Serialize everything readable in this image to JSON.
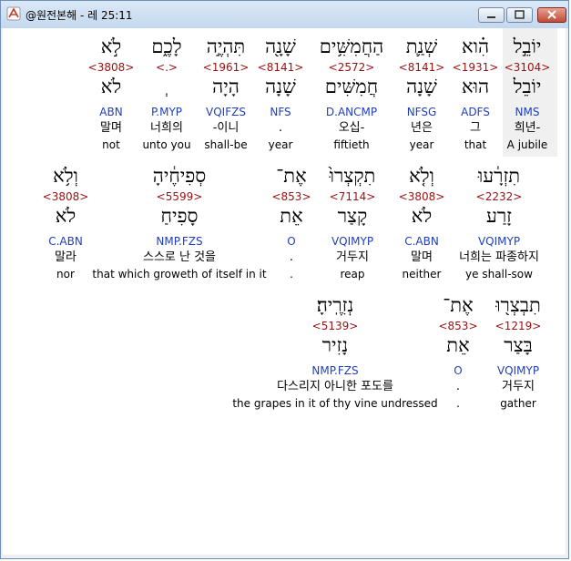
{
  "window": {
    "title": "@원전본해 - 레 25:11",
    "colors": {
      "strong": "#9a1010",
      "parse": "#1f3fbf",
      "highlight": "#f0f0f0"
    }
  },
  "rows": [
    {
      "words": [
        {
          "heb": "יוֹבֵ֣ל",
          "strong": "<3104>",
          "lemma": "יוֹבֵל",
          "parse": "NMS",
          "kor": "희년-",
          "eng": "A jubile"
        },
        {
          "heb": "הִ֗וא",
          "strong": "<1931>",
          "lemma": "הוּא",
          "parse": "ADFS",
          "kor": "그",
          "eng": "that"
        },
        {
          "heb": "שְׁנַ֛ת",
          "strong": "<8141>",
          "lemma": "שָׁנָה",
          "parse": "NFSG",
          "kor": "년은",
          "eng": "year"
        },
        {
          "heb": "הַחֲמִשִּׁ֥ים",
          "strong": "<2572>",
          "lemma": "חֲמִשִּׁים",
          "parse": "D.ANCMP",
          "kor": "오십-",
          "eng": "fiftieth"
        },
        {
          "heb": "שָׁנָ֖ה",
          "strong": "<8141>",
          "lemma": "שָׁנָה",
          "parse": "NFS",
          "kor": ".",
          "eng": "year"
        },
        {
          "heb": "תִּהְיֶ֣ה",
          "strong": "<1961>",
          "lemma": "הָיָה",
          "parse": "VQIFZS",
          "kor": "-이니",
          "eng": "shall-be"
        },
        {
          "heb": "לָכֶ֑ם",
          "strong": "<.>",
          "lemma": "ְ",
          "parse": "P.MYP",
          "kor": "너희의",
          "eng": "unto you"
        },
        {
          "heb": "לֹ֣א",
          "strong": "<3808>",
          "lemma": "לֹא",
          "parse": "ABN",
          "kor": "말며",
          "eng": "not"
        }
      ]
    },
    {
      "words": [
        {
          "heb": "תִזְרָ֔עוּ",
          "strong": "<2232>",
          "lemma": "זָרַע",
          "parse": "VQIMYP",
          "kor": "너희는 파종하지",
          "eng": "ye shall-sow"
        },
        {
          "heb": "וְלֹ֤א",
          "strong": "<3808>",
          "lemma": "לֹא",
          "parse": "C.ABN",
          "kor": "말며",
          "eng": "neither"
        },
        {
          "heb": "תִקְצְרוּ֙",
          "strong": "<7114>",
          "lemma": "קָצַר",
          "parse": "VQIMYP",
          "kor": "거두지",
          "eng": "reap"
        },
        {
          "heb": "אֶת־",
          "strong": "<853>",
          "lemma": "אֵת",
          "parse": "O",
          "kor": ".",
          "eng": "."
        },
        {
          "heb": "סְפִיחֶ֔יהָ",
          "strong": "<5599>",
          "lemma": "סָפִיחַ",
          "parse": "NMP.FZS",
          "kor": "스스로 난 것을",
          "eng": "that which groweth of itself in it"
        },
        {
          "heb": "וְלֹ֥א",
          "strong": "<3808>",
          "lemma": "לֹא",
          "parse": "C.ABN",
          "kor": "말라",
          "eng": "nor"
        }
      ]
    },
    {
      "words": [
        {
          "heb": "תִבְצְר֖וּ",
          "strong": "<1219>",
          "lemma": "בָּצַר",
          "parse": "VQIMYP",
          "kor": "거두지",
          "eng": "gather"
        },
        {
          "heb": "אֶת־",
          "strong": "<853>",
          "lemma": "אֵת",
          "parse": "O",
          "kor": ".",
          "eng": "."
        },
        {
          "heb": "נְזִרֶֽיהָ׃",
          "strong": "<5139>",
          "lemma": "נָזִיר",
          "parse": "NMP.FZS",
          "kor": "다스리지 아니한 포도를",
          "eng": "the grapes in it of thy vine undressed"
        }
      ]
    }
  ]
}
